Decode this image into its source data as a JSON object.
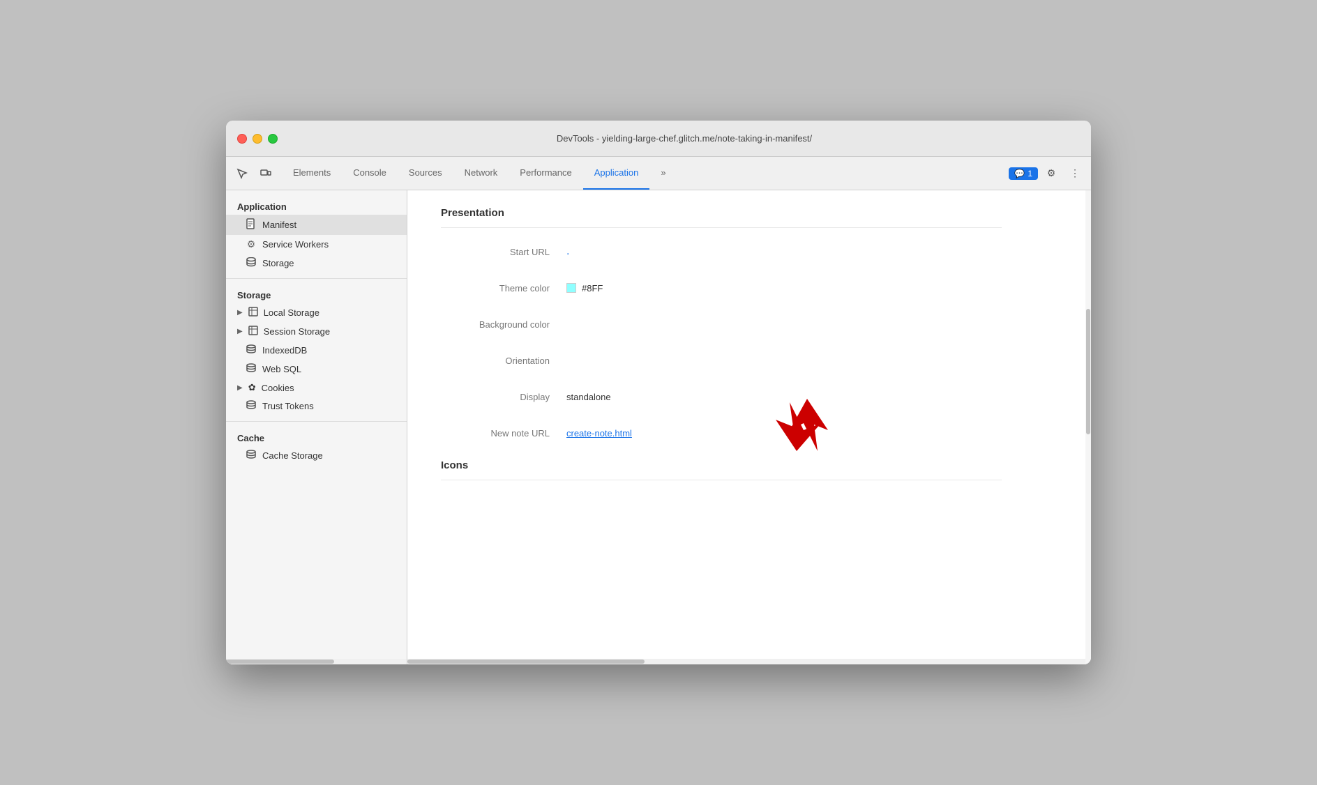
{
  "window": {
    "title": "DevTools - yielding-large-chef.glitch.me/note-taking-in-manifest/"
  },
  "tabs": [
    {
      "id": "elements",
      "label": "Elements",
      "active": false
    },
    {
      "id": "console",
      "label": "Console",
      "active": false
    },
    {
      "id": "sources",
      "label": "Sources",
      "active": false
    },
    {
      "id": "network",
      "label": "Network",
      "active": false
    },
    {
      "id": "performance",
      "label": "Performance",
      "active": false
    },
    {
      "id": "application",
      "label": "Application",
      "active": true
    }
  ],
  "toolbar": {
    "inspect_icon": "⬚",
    "device_icon": "▭",
    "more_icon": "»",
    "chat_label": "1",
    "settings_icon": "⚙",
    "more_vert_icon": "⋮"
  },
  "sidebar": {
    "application_section": "Application",
    "items_application": [
      {
        "id": "manifest",
        "label": "Manifest",
        "icon": "📄",
        "active": true
      },
      {
        "id": "service-workers",
        "label": "Service Workers",
        "icon": "⚙"
      },
      {
        "id": "storage",
        "label": "Storage",
        "icon": "🗄"
      }
    ],
    "storage_section": "Storage",
    "items_storage": [
      {
        "id": "local-storage",
        "label": "Local Storage",
        "expandable": true,
        "icon": "▦"
      },
      {
        "id": "session-storage",
        "label": "Session Storage",
        "expandable": true,
        "icon": "▦"
      },
      {
        "id": "indexeddb",
        "label": "IndexedDB",
        "icon": "🗄"
      },
      {
        "id": "web-sql",
        "label": "Web SQL",
        "icon": "🗄"
      },
      {
        "id": "cookies",
        "label": "Cookies",
        "expandable": true,
        "icon": "✿"
      },
      {
        "id": "trust-tokens",
        "label": "Trust Tokens",
        "icon": "🗄"
      }
    ],
    "cache_section": "Cache",
    "items_cache": [
      {
        "id": "cache-storage",
        "label": "Cache Storage",
        "icon": "🗄"
      }
    ]
  },
  "content": {
    "presentation_title": "Presentation",
    "fields": [
      {
        "label": "Start URL",
        "value": ".",
        "type": "dot-link"
      },
      {
        "label": "Theme color",
        "value": "#8FF",
        "type": "color",
        "color": "#8fffff"
      },
      {
        "label": "Background color",
        "value": "",
        "type": "text"
      },
      {
        "label": "Orientation",
        "value": "",
        "type": "text"
      },
      {
        "label": "Display",
        "value": "standalone",
        "type": "text"
      },
      {
        "label": "New note URL",
        "value": "create-note.html",
        "type": "link"
      }
    ],
    "icons_title": "Icons"
  }
}
